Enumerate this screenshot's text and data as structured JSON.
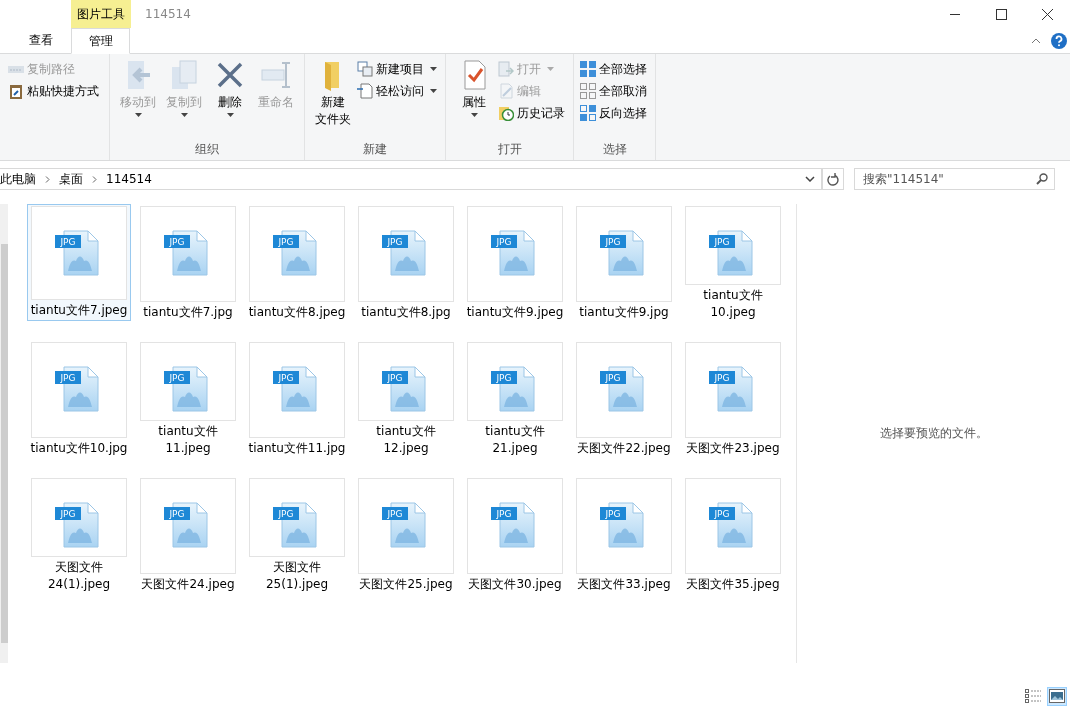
{
  "window": {
    "contextual_tab": "图片工具",
    "title": "114514"
  },
  "tabs": [
    {
      "label": "查看",
      "selected": false
    },
    {
      "label": "管理",
      "selected": true
    }
  ],
  "ribbon": {
    "groups": [
      {
        "small": [
          {
            "label": "复制路径",
            "disabled": true,
            "dropdown": false
          },
          {
            "label": "粘贴快捷方式",
            "disabled": false,
            "dropdown": false
          }
        ]
      },
      {
        "label": "组织",
        "large": [
          {
            "lines": [
              "移动到"
            ],
            "disabled": true,
            "dropdown": true
          },
          {
            "lines": [
              "复制到"
            ],
            "disabled": true,
            "dropdown": true
          },
          {
            "lines": [
              "删除"
            ],
            "disabled": false,
            "dropdown": true
          },
          {
            "lines": [
              "重命名"
            ],
            "disabled": true,
            "dropdown": false
          }
        ]
      },
      {
        "label": "新建",
        "large": [
          {
            "lines": [
              "新建",
              "文件夹"
            ],
            "disabled": false,
            "dropdown": false
          }
        ],
        "small": [
          {
            "label": "新建项目",
            "disabled": false,
            "dropdown": true
          },
          {
            "label": "轻松访问",
            "disabled": false,
            "dropdown": true
          }
        ]
      },
      {
        "label": "打开",
        "large": [
          {
            "lines": [
              "属性"
            ],
            "disabled": false,
            "dropdown": true
          }
        ],
        "small": [
          {
            "label": "打开",
            "disabled": true,
            "dropdown": true
          },
          {
            "label": "编辑",
            "disabled": true,
            "dropdown": false
          },
          {
            "label": "历史记录",
            "disabled": false,
            "dropdown": false
          }
        ]
      },
      {
        "label": "选择",
        "small": [
          {
            "label": "全部选择",
            "disabled": false,
            "dropdown": false
          },
          {
            "label": "全部取消",
            "disabled": false,
            "dropdown": false
          },
          {
            "label": "反向选择",
            "disabled": false,
            "dropdown": false
          }
        ]
      }
    ]
  },
  "address_bar": {
    "breadcrumbs": [
      "此电脑",
      "桌面",
      "114514"
    ]
  },
  "search": {
    "placeholder": "搜索\"114514\""
  },
  "files": [
    {
      "name": "tiantu文件7.jpeg",
      "badge": "JPG",
      "selected": true
    },
    {
      "name": "tiantu文件7.jpg",
      "badge": "JPG",
      "selected": false
    },
    {
      "name": "tiantu文件8.jpeg",
      "badge": "JPG",
      "selected": false
    },
    {
      "name": "tiantu文件8.jpg",
      "badge": "JPG",
      "selected": false
    },
    {
      "name": "tiantu文件9.jpeg",
      "badge": "JPG",
      "selected": false
    },
    {
      "name": "tiantu文件9.jpg",
      "badge": "JPG",
      "selected": false
    },
    {
      "name": "tiantu文件10.jpeg",
      "badge": "JPG",
      "selected": false
    },
    {
      "name": "tiantu文件10.jpg",
      "badge": "JPG",
      "selected": false
    },
    {
      "name": "tiantu文件11.jpeg",
      "badge": "JPG",
      "selected": false
    },
    {
      "name": "tiantu文件11.jpg",
      "badge": "JPG",
      "selected": false
    },
    {
      "name": "tiantu文件12.jpeg",
      "badge": "JPG",
      "selected": false
    },
    {
      "name": "tiantu文件21.jpeg",
      "badge": "JPG",
      "selected": false
    },
    {
      "name": "天图文件22.jpeg",
      "badge": "JPG",
      "selected": false
    },
    {
      "name": "天图文件23.jpeg",
      "badge": "JPG",
      "selected": false
    },
    {
      "name": "天图文件24(1).jpeg",
      "badge": "JPG",
      "selected": false
    },
    {
      "name": "天图文件24.jpeg",
      "badge": "JPG",
      "selected": false
    },
    {
      "name": "天图文件25(1).jpeg",
      "badge": "JPG",
      "selected": false
    },
    {
      "name": "天图文件25.jpeg",
      "badge": "JPG",
      "selected": false
    },
    {
      "name": "天图文件30.jpeg",
      "badge": "JPG",
      "selected": false
    },
    {
      "name": "天图文件33.jpeg",
      "badge": "JPG",
      "selected": false
    },
    {
      "name": "天图文件35.jpeg",
      "badge": "JPG",
      "selected": false
    }
  ],
  "preview_pane": {
    "message": "选择要预览的文件。"
  },
  "status_bar": {
    "views": [
      {
        "kind": "details",
        "selected": false
      },
      {
        "kind": "thumbnails",
        "selected": true
      }
    ]
  }
}
